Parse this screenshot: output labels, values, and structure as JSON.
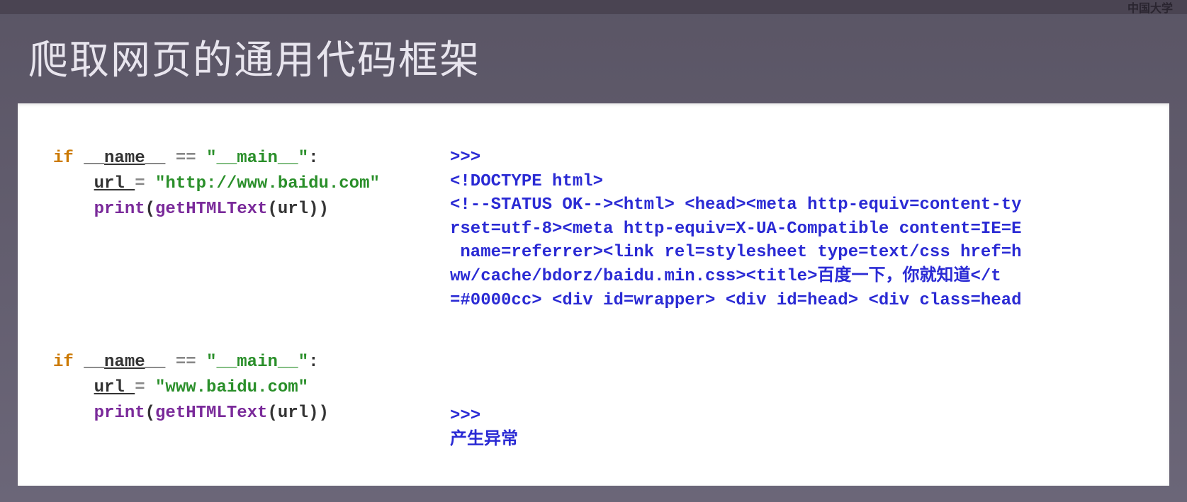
{
  "header": {
    "watermark": "中国大学"
  },
  "slide": {
    "title": "爬取网页的通用代码框架"
  },
  "examples": [
    {
      "code": {
        "line1_if": "if",
        "line1_name_pre": " __",
        "line1_name": "name",
        "line1_name_post": "__ ",
        "line1_eq": "==",
        "line1_str": " \"__main__\"",
        "line1_colon": ":",
        "line2_indent": "    ",
        "line2_var": "url ",
        "line2_eq": "=",
        "line2_url": " \"http://www.baidu.com\"",
        "line3_indent": "    ",
        "line3_print": "print",
        "line3_open": "(",
        "line3_func": "getHTMLText",
        "line3_open2": "(",
        "line3_arg": "url",
        "line3_close": "))"
      },
      "output": {
        "prompt": ">>>",
        "body": "<!DOCTYPE html>\n<!--STATUS OK--><html> <head><meta http-equiv=content-ty\nrset=utf-8><meta http-equiv=X-UA-Compatible content=IE=E\n name=referrer><link rel=stylesheet type=text/css href=h\nww/cache/bdorz/baidu.min.css><title>百度一下，你就知道</t\n=#0000cc> <div id=wrapper> <div id=head> <div class=head"
      }
    },
    {
      "code": {
        "line1_if": "if",
        "line1_name_pre": " __",
        "line1_name": "name",
        "line1_name_post": "__ ",
        "line1_eq": "==",
        "line1_str": " \"__main__\"",
        "line1_colon": ":",
        "line2_indent": "    ",
        "line2_var": "url ",
        "line2_eq": "=",
        "line2_url": " \"www.baidu.com\"",
        "line3_indent": "    ",
        "line3_print": "print",
        "line3_open": "(",
        "line3_func": "getHTMLText",
        "line3_open2": "(",
        "line3_arg": "url",
        "line3_close": "))"
      },
      "output": {
        "prompt": ">>>",
        "body": "产生异常"
      }
    }
  ]
}
